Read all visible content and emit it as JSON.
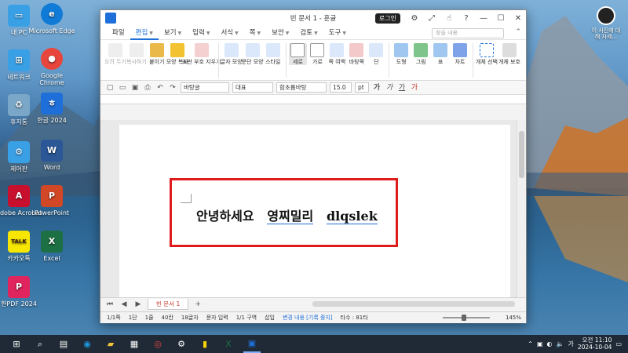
{
  "desktop": {
    "icons": [
      {
        "label": "내 PC",
        "color": "#3aa0e6"
      },
      {
        "label": "Microsoft Edge",
        "color": "#0f7bd6"
      },
      {
        "label": "네트워크",
        "color": "#3aa0e6"
      },
      {
        "label": "Google Chrome",
        "color": "#e8453c"
      },
      {
        "label": "휴지통",
        "color": "#7aa7c7"
      },
      {
        "label": "한글 2024",
        "color": "#1e6fd9"
      },
      {
        "label": "제어판",
        "color": "#3aa0e6"
      },
      {
        "label": "Word",
        "color": "#2b5797"
      },
      {
        "label": "Adobe Acrobat",
        "color": "#c8102e"
      },
      {
        "label": "PowerPoint",
        "color": "#d24726"
      },
      {
        "label": "카카오톡",
        "color": "#f7e600"
      },
      {
        "label": "Excel",
        "color": "#1d7044"
      },
      {
        "label": "한PDF 2024",
        "color": "#e0245e"
      }
    ],
    "right_icon": {
      "label": "이 사진에 대해 자세..."
    }
  },
  "window": {
    "title": "빈 문서 1 - 훈글",
    "login_label": "로그인",
    "menus": [
      "파일",
      "편집",
      "보기",
      "입력",
      "서식",
      "쪽",
      "보안",
      "검토",
      "도구"
    ],
    "active_menu": "편집",
    "search_placeholder": "찾을 내용",
    "ribbon": [
      {
        "label": "오려 두기",
        "dim": true
      },
      {
        "label": "복사하기",
        "dim": true
      },
      {
        "label": "붙이기",
        "dim": false
      },
      {
        "label": "모양 복사",
        "dim": false
      },
      {
        "label": "조판 부호 지우기",
        "dim": false
      },
      {
        "label": "글자 모양",
        "dim": false
      },
      {
        "label": "문단 모양",
        "dim": false
      },
      {
        "label": "스타일",
        "dim": false
      },
      {
        "label": "세로",
        "dim": false,
        "selected": true
      },
      {
        "label": "가로",
        "dim": false
      },
      {
        "label": "쪽 여백",
        "dim": false
      },
      {
        "label": "바탕쪽",
        "dim": false
      },
      {
        "label": "단",
        "dim": false
      },
      {
        "label": "도형",
        "dim": false
      },
      {
        "label": "그림",
        "dim": false
      },
      {
        "label": "표",
        "dim": false
      },
      {
        "label": "차트",
        "dim": false
      },
      {
        "label": "개체 선택",
        "dim": false
      },
      {
        "label": "개체 보호",
        "dim": false
      }
    ],
    "format_bar": {
      "style": "바탕글",
      "lang": "대표",
      "font": "함초롬바탕",
      "size": "15.0",
      "unit": "pt"
    },
    "document_text": {
      "part1": "안녕하세요",
      "part2": "영찌밀리",
      "part3": "dlqslek"
    },
    "doc_tab": "빈 문서 1",
    "status": {
      "page": "1/1쪽",
      "section": "1단",
      "line": "1줄",
      "col": "40칸",
      "chars": "18글자",
      "mode": "문자 입력",
      "zone": "1/1 구역",
      "insert": "삽입",
      "track": "변경 내용 [기록 중지]",
      "strokes": "타수 : 81타",
      "zoom": "145%"
    }
  },
  "taskbar": {
    "time": "오전 11:10",
    "date": "2024-10-04",
    "lang": "가"
  }
}
